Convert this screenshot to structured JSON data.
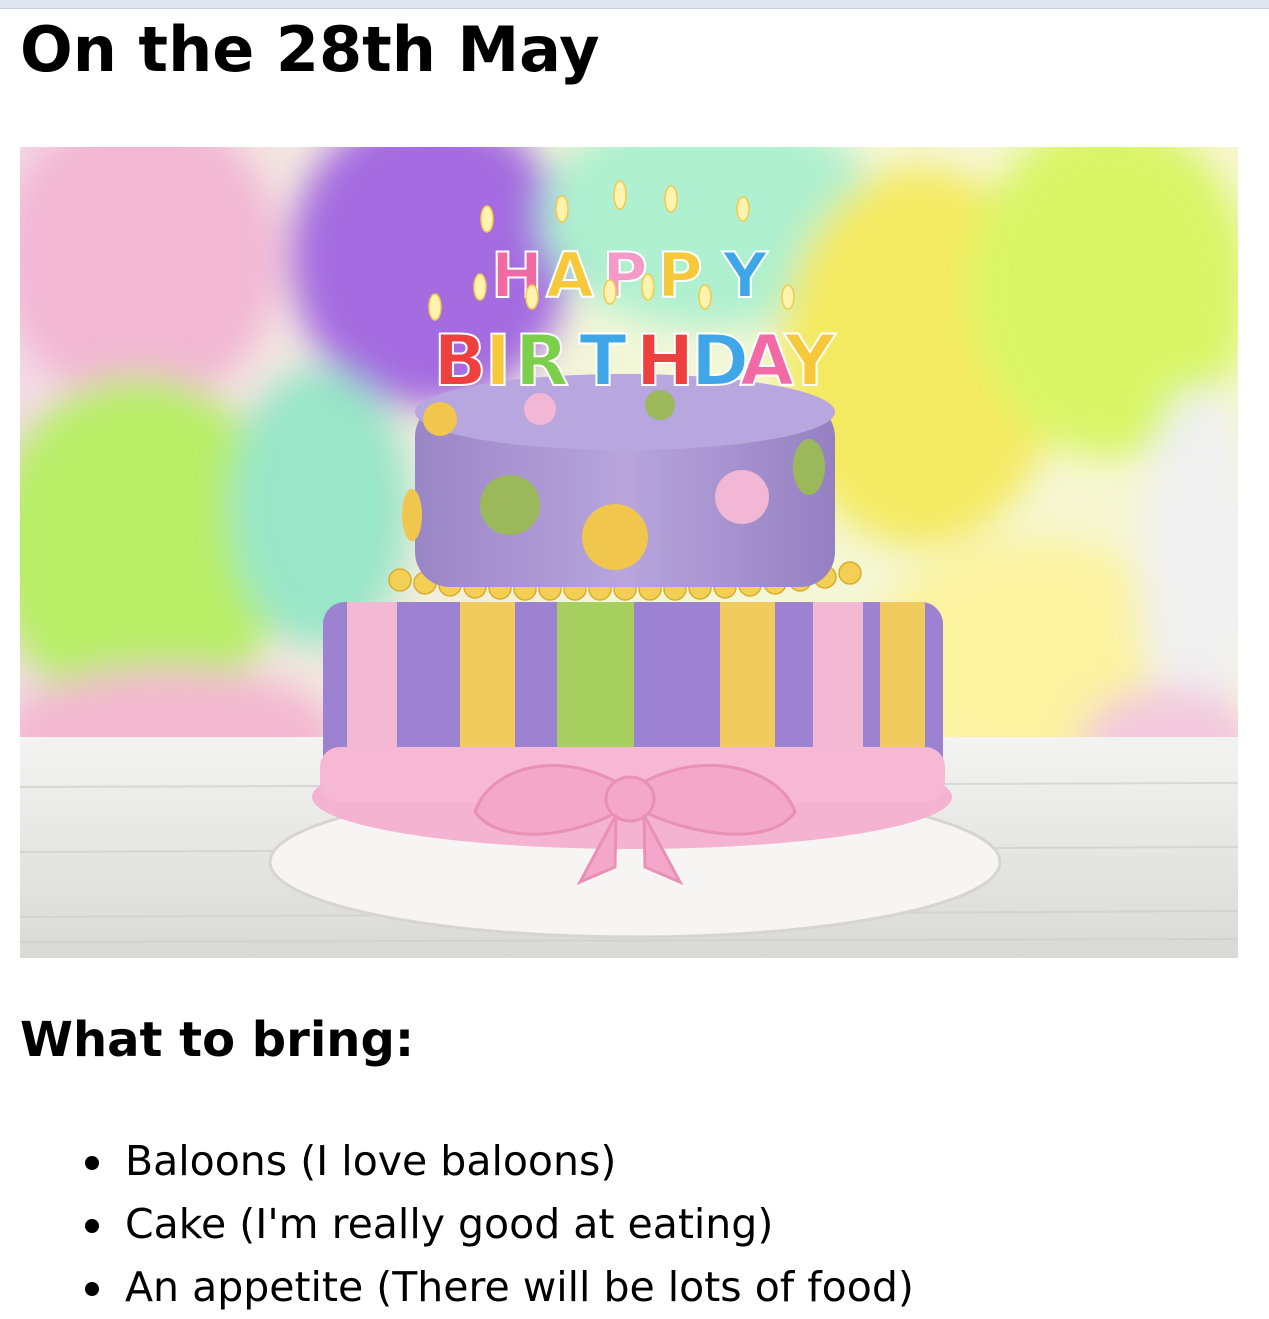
{
  "page": {
    "title": "On the 28th May",
    "hero_image": {
      "candles_row1": "HAPPY",
      "candles_row2": "BIRTHDAY",
      "candle_colors": [
        "#f26aa5",
        "#f5c93a",
        "#3fa7e8",
        "#7bcf4a",
        "#9b59d6",
        "#ef4040"
      ]
    },
    "section_heading": "What to bring:",
    "items": [
      "Baloons (I love baloons)",
      "Cake (I'm really good at eating)",
      "An appetite (There will be lots of food)"
    ]
  }
}
